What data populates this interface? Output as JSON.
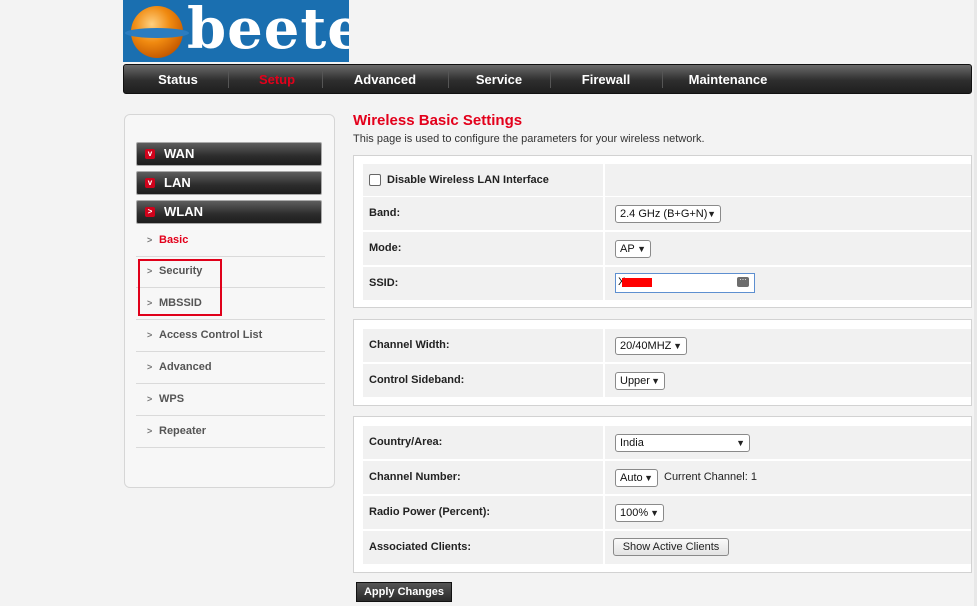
{
  "brand": {
    "logo_text": "beetel"
  },
  "nav": {
    "items": [
      {
        "label": "Status"
      },
      {
        "label": "Setup",
        "active": true
      },
      {
        "label": "Advanced"
      },
      {
        "label": "Service"
      },
      {
        "label": "Firewall"
      },
      {
        "label": "Maintenance"
      }
    ]
  },
  "sidebar": {
    "categories": [
      {
        "label": "WAN",
        "badge": "v"
      },
      {
        "label": "LAN",
        "badge": "v"
      },
      {
        "label": "WLAN",
        "badge": ">"
      }
    ],
    "items": [
      {
        "label": "Basic",
        "active": true
      },
      {
        "label": "Security"
      },
      {
        "label": "MBSSID"
      },
      {
        "label": "Access Control List"
      },
      {
        "label": "Advanced"
      },
      {
        "label": "WPS"
      },
      {
        "label": "Repeater"
      }
    ],
    "arrow_glyph": ">"
  },
  "page": {
    "title": "Wireless Basic Settings",
    "description": "This page is used to configure the parameters for your wireless network."
  },
  "basic": {
    "disable_label": "Disable Wireless LAN Interface",
    "band_label": "Band:",
    "band_value": "2.4 GHz (B+G+N)",
    "mode_label": "Mode:",
    "mode_value": "AP",
    "ssid_label": "SSID:",
    "ssid_value": "X"
  },
  "channel": {
    "width_label": "Channel Width:",
    "width_value": "20/40MHZ",
    "sideband_label": "Control Sideband:",
    "sideband_value": "Upper"
  },
  "radio": {
    "country_label": "Country/Area:",
    "country_value": "India",
    "channel_label": "Channel Number:",
    "channel_value": "Auto",
    "current_channel": "Current Channel: 1",
    "power_label": "Radio Power (Percent):",
    "power_value": "100%",
    "clients_label": "Associated Clients:",
    "clients_button": "Show Active Clients"
  },
  "actions": {
    "apply_label": "Apply Changes"
  },
  "icons": {
    "dropdown": "chevron-down-icon",
    "keyboard": "keyboard-icon",
    "redaction": "#ff0000"
  },
  "colors": {
    "accent": "#e3001b",
    "brand_blue": "#1a6fb0"
  }
}
